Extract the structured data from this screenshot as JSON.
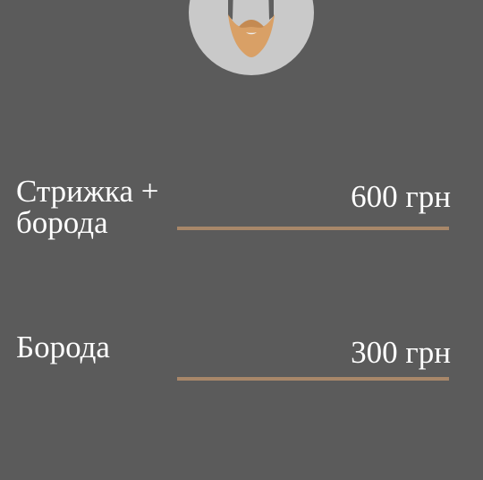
{
  "icon": {
    "name": "bearded-man-icon",
    "circle_color": "#c9c9c9",
    "beard_color": "#d9a066",
    "beard_shadow_color": "#c48a52"
  },
  "services": [
    {
      "name": "Стрижка + борода",
      "price": "600 грн"
    },
    {
      "name": "Борода",
      "price": "300 грн"
    }
  ],
  "colors": {
    "background": "#5b5b5b",
    "text": "#ffffff",
    "divider": "#a88769"
  }
}
